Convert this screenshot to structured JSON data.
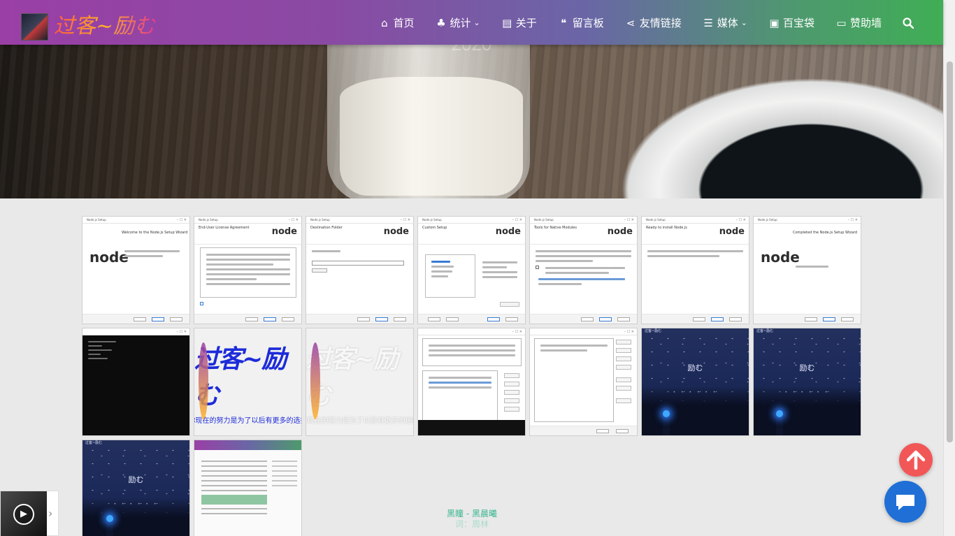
{
  "brand": {
    "title": "过客~励む"
  },
  "hero": {
    "year": "2020"
  },
  "nav": {
    "items": [
      {
        "label": "首页",
        "icon": "home-icon",
        "glyph": "⌂",
        "dropdown": false
      },
      {
        "label": "统计",
        "icon": "sitemap-icon",
        "glyph": "♣",
        "dropdown": true
      },
      {
        "label": "关于",
        "icon": "id-card-icon",
        "glyph": "▤",
        "dropdown": false
      },
      {
        "label": "留言板",
        "icon": "comments-icon",
        "glyph": "❝",
        "dropdown": false
      },
      {
        "label": "友情链接",
        "icon": "share-icon",
        "glyph": "⋖",
        "dropdown": false
      },
      {
        "label": "媒体",
        "icon": "list-icon",
        "glyph": "☰",
        "dropdown": true
      },
      {
        "label": "百宝袋",
        "icon": "briefcase-icon",
        "glyph": "▣",
        "dropdown": false
      },
      {
        "label": "赞助墙",
        "icon": "credit-card-icon",
        "glyph": "▭",
        "dropdown": false
      }
    ],
    "search_icon": "search-icon",
    "dropdown_caret": "⌄"
  },
  "gallery": {
    "setup": [
      {
        "window": "Node.js Setup",
        "heading": "Welcome to the Node.js Setup Wizard"
      },
      {
        "window": "Node.js Setup",
        "heading": "End-User License Agreement"
      },
      {
        "window": "Node.js Setup",
        "heading": "Destination Folder"
      },
      {
        "window": "Node.js Setup",
        "heading": "Custom Setup"
      },
      {
        "window": "Node.js Setup",
        "heading": "Tools for Native Modules"
      },
      {
        "window": "Node.js Setup",
        "heading": "Ready to install Node.js"
      },
      {
        "window": "Node.js Setup",
        "heading": "Completed the Node.js Setup Wizard"
      }
    ],
    "node_logo": "node",
    "brand_text": "过客~励む",
    "brand_sub": "你现在的努力是为了以后有更多的选择",
    "night_word": "励む",
    "night_title": "过客~励む"
  },
  "music": {
    "play_icon": "play-icon",
    "line1": "黑瞳 - 黑晨曦",
    "line2": "词：周林"
  },
  "colors": {
    "accent_top": "#f25757",
    "chat": "#1f6fd6",
    "node_green": "#5fa04e",
    "lyric": "#39b58f"
  }
}
